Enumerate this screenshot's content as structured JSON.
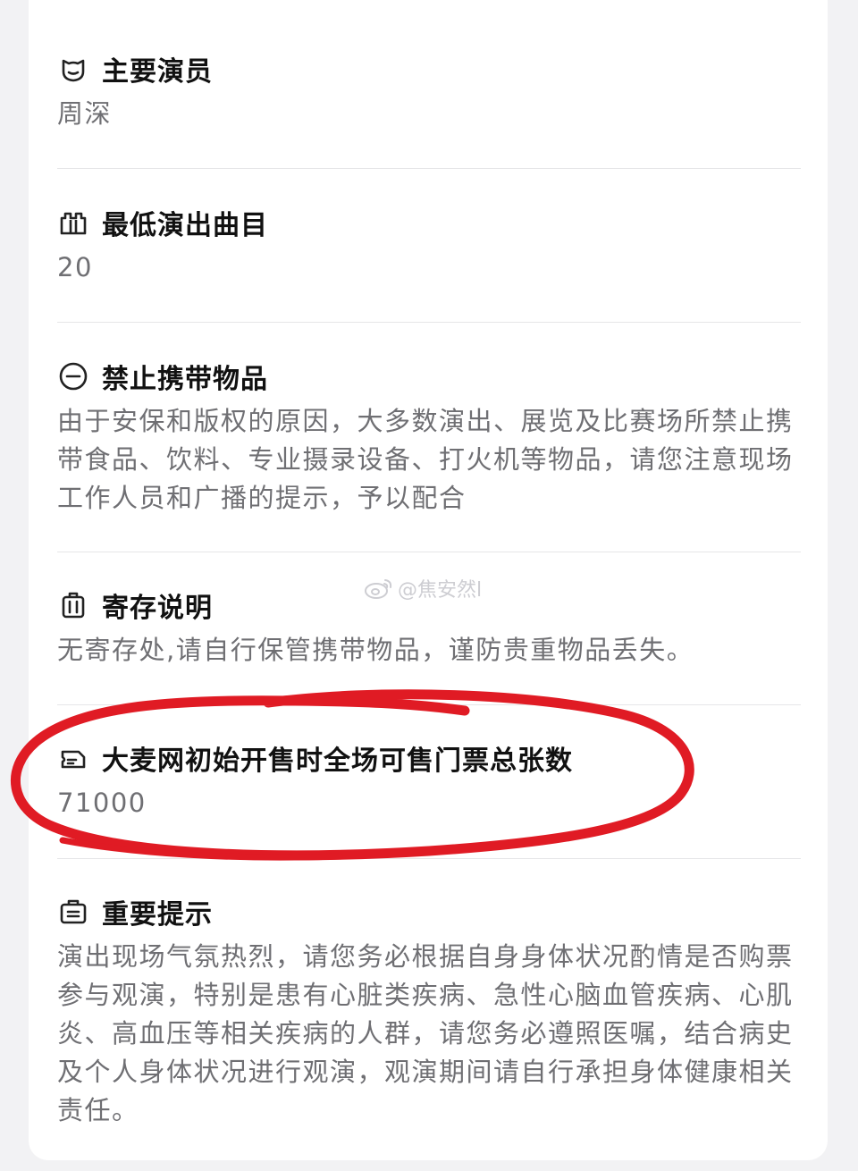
{
  "sections": [
    {
      "icon": "face-mask-icon",
      "title": "主要演员",
      "value": "周深"
    },
    {
      "icon": "crown-icon",
      "title": "最低演出曲目",
      "value": "20"
    },
    {
      "icon": "minus-circle-icon",
      "title": "禁止携带物品",
      "value": "由于安保和版权的原因，大多数演出、展览及比赛场所禁止携带食品、饮料、专业摄录设备、打火机等物品，请您注意现场工作人员和广播的提示，予以配合"
    },
    {
      "icon": "luggage-icon",
      "title": "寄存说明",
      "value": "无寄存处,请自行保管携带物品，谨防贵重物品丢失。"
    },
    {
      "icon": "ticket-icon",
      "title": "大麦网初始开售时全场可售门票总张数",
      "value": "71000"
    },
    {
      "icon": "notice-icon",
      "title": "重要提示",
      "value": "演出现场气氛热烈，请您务必根据自身身体状况酌情是否购票参与观演，特别是患有心脏类疾病、急性心脑血管疾病、心肌炎、高血压等相关疾病的人群，请您务必遵照医嘱，结合病史及个人身体状况进行观演，观演期间请自行承担身体健康相关责任。"
    }
  ],
  "watermark": {
    "icon": "weibo-icon",
    "text": "@焦安然l"
  },
  "annotation": {
    "color": "#e01b24"
  }
}
